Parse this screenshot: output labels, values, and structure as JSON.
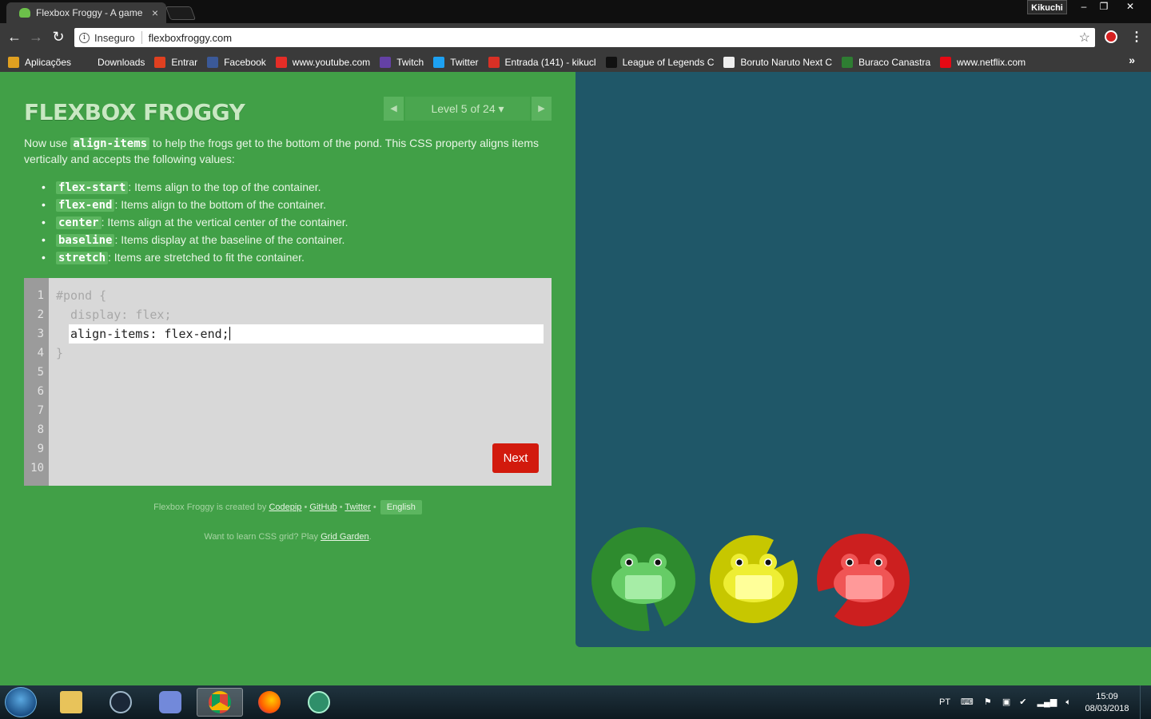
{
  "browser": {
    "tab_title": "Flexbox Froggy - A game",
    "tab_close": "×",
    "profile": "Kikuchi",
    "window_controls": [
      "–",
      "❐",
      "✕"
    ],
    "back": "←",
    "forward": "→",
    "reload": "↻",
    "security_label": "Inseguro",
    "url": "flexboxfroggy.com",
    "star": "☆",
    "menu": "⋮",
    "bookmarks_more": "»",
    "bookmarks": [
      {
        "label": "Aplicações",
        "icon": "apps-grid-icon",
        "color": "#e0a020"
      },
      {
        "label": "Downloads",
        "icon": "download-icon",
        "color": "#3a3a3a"
      },
      {
        "label": "Entrar",
        "icon": "microsoft-icon",
        "color": "#e04020"
      },
      {
        "label": "Facebook",
        "icon": "facebook-icon",
        "color": "#3b5998"
      },
      {
        "label": "www.youtube.com",
        "icon": "youtube-icon",
        "color": "#e52d27"
      },
      {
        "label": "Twitch",
        "icon": "twitch-icon",
        "color": "#6441a5"
      },
      {
        "label": "Twitter",
        "icon": "twitter-icon",
        "color": "#1da1f2"
      },
      {
        "label": "Entrada (141) - kikucl",
        "icon": "gmail-icon",
        "color": "#d93025"
      },
      {
        "label": "League of Legends C",
        "icon": "pb-icon",
        "color": "#111111"
      },
      {
        "label": "Boruto Naruto Next C",
        "icon": "boruto-icon",
        "color": "#eeeeee"
      },
      {
        "label": "Buraco Canastra",
        "icon": "cards-icon",
        "color": "#2e7d32"
      },
      {
        "label": "www.netflix.com",
        "icon": "netflix-icon",
        "color": "#e50914"
      }
    ]
  },
  "game": {
    "logo": "FLEXBOX FROGGY",
    "level_label": "Level 5 of 24 ▾",
    "prev_arrow": "◀",
    "next_arrow": "▶",
    "intro_before": "Now use ",
    "intro_code": "align-items",
    "intro_after": " to help the frogs get to the bottom of the pond. This CSS property aligns items vertically and accepts the following values:",
    "options": [
      {
        "code": "flex-start",
        "text": ": Items align to the top of the container."
      },
      {
        "code": "flex-end",
        "text": ": Items align to the bottom of the container."
      },
      {
        "code": "center",
        "text": ": Items align at the vertical center of the container."
      },
      {
        "code": "baseline",
        "text": ": Items display at the baseline of the container."
      },
      {
        "code": "stretch",
        "text": ": Items are stretched to fit the container."
      }
    ],
    "line_numbers": [
      "1",
      "2",
      "3",
      "4",
      "5",
      "6",
      "7",
      "8",
      "9",
      "10"
    ],
    "code_line1": "#pond {",
    "code_line2": "  display: flex;",
    "code_input": "align-items: flex-end;",
    "code_line4": "}",
    "next_button": "Next",
    "credits_prefix": "Flexbox Froggy is created by ",
    "credits_codepip": "Codepip",
    "credits_sep": " • ",
    "credits_github": "GitHub",
    "credits_twitter": "Twitter",
    "language": "English",
    "learn_prefix": "Want to learn CSS grid? Play ",
    "learn_link": "Grid Garden",
    "learn_suffix": ".",
    "frogs": [
      {
        "color": "green",
        "lily": "#2e8b2e",
        "body": "#66cc66",
        "belly": "#a6eda6"
      },
      {
        "color": "yellow",
        "lily": "#c7c700",
        "body": "#eeee33",
        "belly": "#ffff99"
      },
      {
        "color": "red",
        "lily": "#cc1f1f",
        "body": "#f05555",
        "belly": "#ff9999"
      }
    ]
  },
  "taskbar": {
    "apps": [
      "explorer",
      "steam",
      "discord",
      "chrome",
      "firefox",
      "atom"
    ],
    "language": "PT",
    "time": "15:09",
    "date": "08/03/2018"
  }
}
